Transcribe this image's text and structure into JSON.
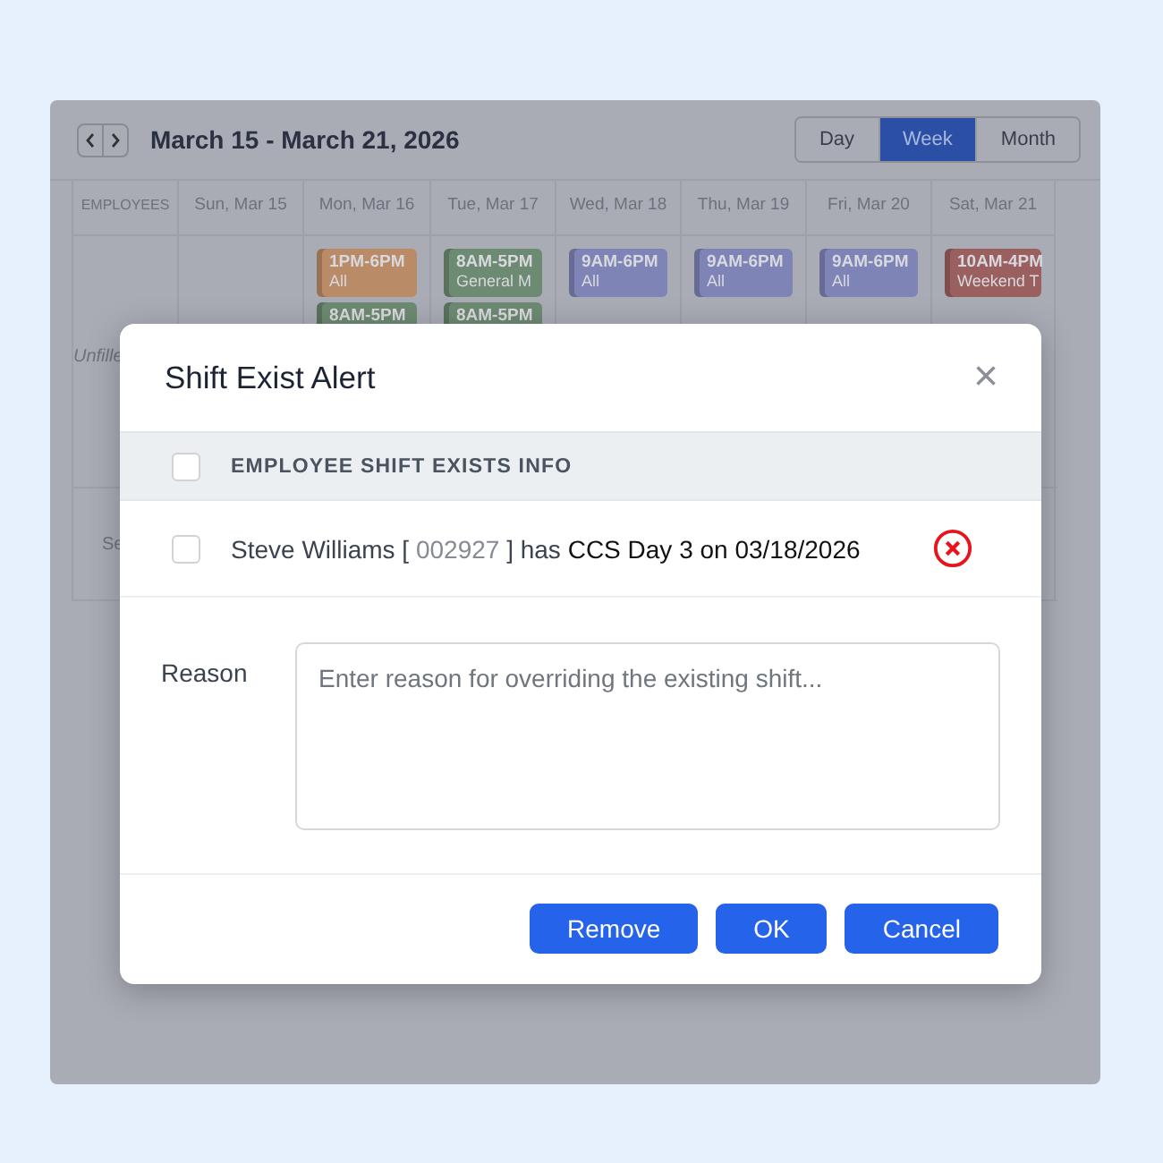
{
  "calendar": {
    "range_title": "March 15 - March 21, 2026",
    "views": [
      {
        "label": "Day",
        "selected": false
      },
      {
        "label": "Week",
        "selected": true
      },
      {
        "label": "Month",
        "selected": false
      }
    ],
    "columns": [
      "EMPLOYEES",
      "Sun, Mar 15",
      "Mon, Mar 16",
      "Tue, Mar 17",
      "Wed, Mar 18",
      "Thu, Mar 19",
      "Fri, Mar 20",
      "Sat, Mar 21"
    ],
    "rows": [
      {
        "label": "Unfille",
        "italic": true,
        "days": {
          "mon": [
            {
              "time": "1PM-6PM",
              "detail": "All",
              "color": "#b98b66"
            },
            {
              "time": "8AM-5PM",
              "color": "#6d8a72"
            }
          ],
          "tue": [
            {
              "time": "8AM-5PM",
              "detail": "General M",
              "color": "#6d8a72"
            },
            {
              "time": "8AM-5PM",
              "color": "#6d8a72"
            }
          ],
          "wed": [
            {
              "time": "9AM-6PM",
              "detail": "All",
              "color": "#7f84b6"
            }
          ],
          "thu": [
            {
              "time": "9AM-6PM",
              "detail": "All",
              "color": "#7f84b6"
            }
          ],
          "fri": [
            {
              "time": "9AM-6PM",
              "detail": "All",
              "color": "#7f84b6"
            }
          ],
          "sat": [
            {
              "time": "10AM-4PM",
              "detail": "Weekend T",
              "color": "#9a605f"
            }
          ]
        }
      },
      {
        "label": "Se",
        "italic": false
      }
    ]
  },
  "modal": {
    "title": "Shift Exist Alert",
    "close": "×",
    "table": {
      "header": {
        "label": "EMPLOYEE SHIFT EXISTS INFO",
        "checked": false
      },
      "rows": [
        {
          "checked": false,
          "parts": [
            {
              "text": "Steve Williams [ ",
              "kind": "plain"
            },
            {
              "text": "002927",
              "kind": "code"
            },
            {
              "text": " ] has ",
              "kind": "plain"
            },
            {
              "text": "CCS Day 3 on 03/18/2026",
              "kind": "detail"
            }
          ]
        }
      ]
    },
    "reason": {
      "label": "Reason",
      "placeholder": "Enter reason for overriding the existing shift..."
    },
    "buttons": [
      "Remove",
      "OK",
      "Cancel"
    ]
  }
}
